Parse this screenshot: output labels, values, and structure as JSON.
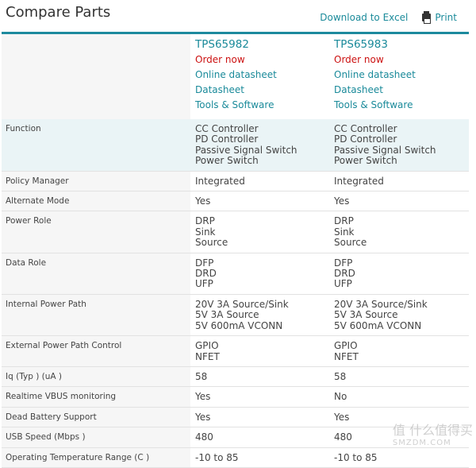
{
  "header": {
    "title": "Compare Parts",
    "download_label": "Download to Excel",
    "print_label": "Print"
  },
  "parts": [
    {
      "name": "TPS65982",
      "order": "Order now",
      "online_datasheet": "Online datasheet",
      "datasheet": "Datasheet",
      "tools": "Tools & Software"
    },
    {
      "name": "TPS65983",
      "order": "Order now",
      "online_datasheet": "Online datasheet",
      "datasheet": "Datasheet",
      "tools": "Tools & Software"
    }
  ],
  "rows": [
    {
      "label": "Function",
      "v1": [
        "CC Controller",
        "PD Controller",
        "Passive Signal Switch",
        "Power Switch"
      ],
      "v2": [
        "CC Controller",
        "PD Controller",
        "Passive Signal Switch",
        "Power Switch"
      ]
    },
    {
      "label": "Policy Manager",
      "v1": [
        "Integrated"
      ],
      "v2": [
        "Integrated"
      ]
    },
    {
      "label": "Alternate Mode",
      "v1": [
        "Yes"
      ],
      "v2": [
        "Yes"
      ]
    },
    {
      "label": "Power Role",
      "v1": [
        "DRP",
        "Sink",
        "Source"
      ],
      "v2": [
        "DRP",
        "Sink",
        "Source"
      ]
    },
    {
      "label": "Data Role",
      "v1": [
        "DFP",
        "DRD",
        "UFP"
      ],
      "v2": [
        "DFP",
        "DRD",
        "UFP"
      ]
    },
    {
      "label": "Internal Power Path",
      "v1": [
        "20V 3A Source/Sink",
        "5V 3A Source",
        "5V 600mA VCONN"
      ],
      "v2": [
        "20V 3A Source/Sink",
        "5V 3A Source",
        "5V 600mA VCONN"
      ]
    },
    {
      "label": "External Power Path Control",
      "v1": [
        "GPIO",
        "NFET"
      ],
      "v2": [
        "GPIO",
        "NFET"
      ]
    },
    {
      "label": "Iq (Typ ) (uA )",
      "v1": [
        "58"
      ],
      "v2": [
        "58"
      ]
    },
    {
      "label": "Realtime VBUS monitoring",
      "v1": [
        "Yes"
      ],
      "v2": [
        "No"
      ]
    },
    {
      "label": "Dead Battery Support",
      "v1": [
        "Yes"
      ],
      "v2": [
        "Yes"
      ]
    },
    {
      "label": "USB Speed (Mbps )",
      "v1": [
        "480"
      ],
      "v2": [
        "480"
      ]
    },
    {
      "label": "Operating Temperature Range (C )",
      "v1": [
        "-10 to 85"
      ],
      "v2": [
        "-10 to 85"
      ]
    }
  ],
  "watermark": {
    "line1": "值 什么值得买",
    "line2": "SMZDM.COM"
  }
}
